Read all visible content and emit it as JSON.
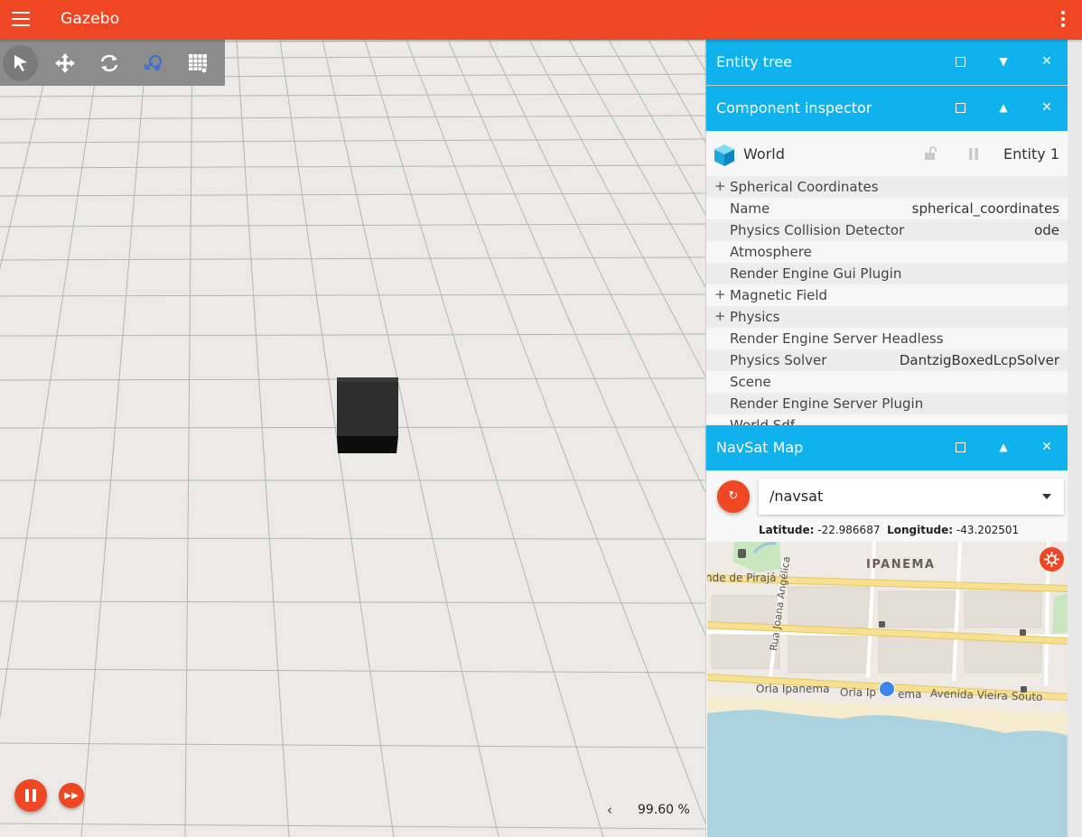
{
  "header": {
    "title": "Gazebo"
  },
  "scene": {
    "rtf_value": "99.60 %",
    "rtf_arrow": "‹"
  },
  "entity_tree": {
    "title": "Entity tree"
  },
  "inspector": {
    "title": "Component inspector",
    "entity_name": "World",
    "entity_id": "Entity 1",
    "components": [
      {
        "label": "Spherical Coordinates",
        "value": "",
        "expandable": true
      },
      {
        "label": "Name",
        "value": "spherical_coordinates",
        "expandable": false
      },
      {
        "label": "Physics Collision Detector",
        "value": "ode",
        "expandable": false
      },
      {
        "label": "Atmosphere",
        "value": "",
        "expandable": false
      },
      {
        "label": "Render Engine Gui Plugin",
        "value": "",
        "expandable": false
      },
      {
        "label": "Magnetic Field",
        "value": "",
        "expandable": true
      },
      {
        "label": "Physics",
        "value": "",
        "expandable": true
      },
      {
        "label": "Render Engine Server Headless",
        "value": "",
        "expandable": false
      },
      {
        "label": "Physics Solver",
        "value": "DantzigBoxedLcpSolver",
        "expandable": false
      },
      {
        "label": "Scene",
        "value": "",
        "expandable": false
      },
      {
        "label": "Render Engine Server Plugin",
        "value": "",
        "expandable": false
      },
      {
        "label": "World Sdf",
        "value": "",
        "expandable": false
      }
    ]
  },
  "navsat": {
    "title": "NavSat Map",
    "topic": "/navsat",
    "latitude_label": "Latitude:",
    "latitude": "-22.986687",
    "longitude_label": "Longitude:",
    "longitude": "-43.202501",
    "map_labels": {
      "district": "IPANEMA",
      "pirajá": "nde de Pirajá",
      "rua": "Rua Joana Angélica",
      "orla1": "Orla Ipanema",
      "orla2": "Orla Ip",
      "orla3": "ema",
      "vieira": "Avenida Vieira Souto"
    }
  },
  "icons": {
    "menu": "hamburger-icon",
    "more": "more-vert-icon",
    "select": "select-arrow-icon",
    "translate": "translate-icon",
    "rotate": "rotate-icon",
    "transform": "transform-control-icon",
    "grid": "grid-icon"
  },
  "colors": {
    "header": "#ef4723",
    "panel_title": "#0fb2ed",
    "gps_dot": "#3d85e6",
    "water": "#aad3df"
  }
}
